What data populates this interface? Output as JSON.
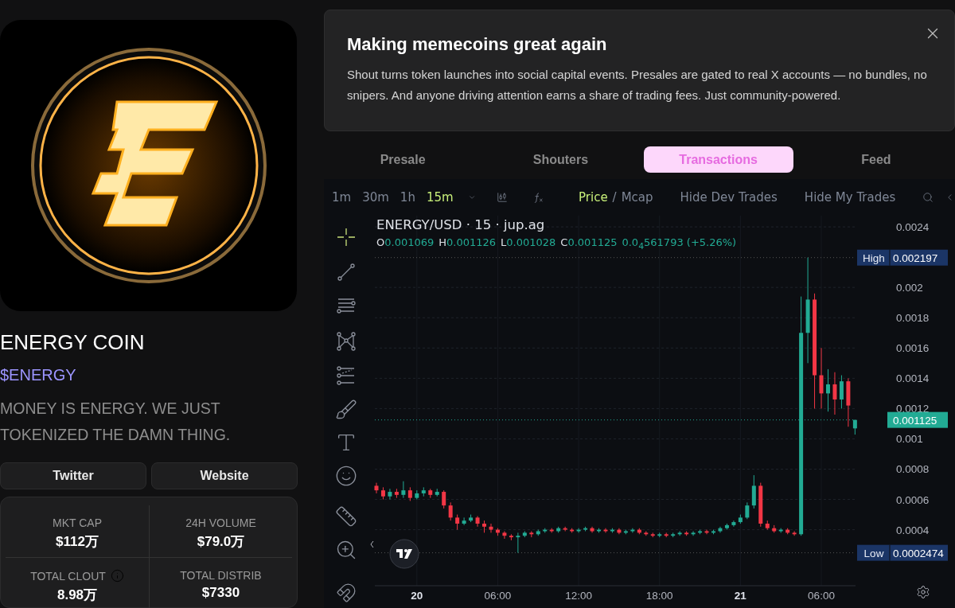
{
  "token": {
    "name": "ENERGY COIN",
    "ticker": "$ENERGY",
    "tagline": "MONEY IS ENERGY. WE JUST TOKENIZED THE DAMN THING."
  },
  "links": [
    "Twitter",
    "Website"
  ],
  "stats": [
    {
      "label": "MKT CAP",
      "value": "$112万",
      "info": false
    },
    {
      "label": "24H VOLUME",
      "value": "$79.0万",
      "info": false
    },
    {
      "label": "TOTAL CLOUT",
      "value": "8.98万",
      "info": true
    },
    {
      "label": "TOTAL DISTRIB",
      "value": "$7330",
      "info": false
    }
  ],
  "banner": {
    "title": "Making memecoins great again",
    "body": "Shout turns token launches into social capital events. Presales are gated to real X accounts — no bundles, no snipers. And anyone driving attention earns a share of trading fees. Just community-powered."
  },
  "tabs": [
    {
      "label": "Presale",
      "selected": false
    },
    {
      "label": "Shouters",
      "selected": false
    },
    {
      "label": "Transactions",
      "selected": true
    },
    {
      "label": "Feed",
      "selected": false
    }
  ],
  "chart": {
    "intervals": [
      {
        "label": "1m",
        "selected": false
      },
      {
        "label": "30m",
        "selected": false
      },
      {
        "label": "1h",
        "selected": false
      },
      {
        "label": "15m",
        "selected": true
      }
    ],
    "modes": [
      {
        "label": "Price",
        "selected": true
      },
      {
        "label": "Mcap",
        "selected": false
      }
    ],
    "mode_separator": "/",
    "toggles": [
      "Hide Dev Trades",
      "Hide My Trades"
    ],
    "symbol": "ENERGY/USD · 15 · jup.ag",
    "ohlc": [
      {
        "key": "O",
        "value": "0.001069"
      },
      {
        "key": "H",
        "value": "0.001126"
      },
      {
        "key": "L",
        "value": "0.001028"
      },
      {
        "key": "C",
        "value": "0.001125"
      }
    ],
    "change": "0.0$_{4}$561793 (+5.26%)",
    "x_labels_bold": [
      true,
      false,
      false,
      false,
      true,
      false
    ],
    "chart_data": {
      "type": "candlestick",
      "grid": true,
      "ylim": [
        3e-05,
        0.002474
      ],
      "yticks": [
        0.0024,
        0.002,
        0.0018,
        0.0016,
        0.0014,
        0.0012,
        0.001,
        0.0008,
        0.0006,
        0.0004
      ],
      "ref_lines": [
        {
          "axis": "y",
          "value": 0.002197,
          "color": "#555555"
        },
        {
          "axis": "y",
          "value": 0.0002474,
          "color": "#555555"
        },
        {
          "axis": "y",
          "value": 0.001125,
          "color": "#22ab94"
        }
      ],
      "categories": [
        null,
        null,
        null,
        null,
        null,
        null,
        "20",
        null,
        null,
        null,
        null,
        null,
        null,
        null,
        null,
        null,
        null,
        null,
        "06:00",
        null,
        null,
        null,
        null,
        null,
        null,
        null,
        null,
        null,
        null,
        null,
        "12:00",
        null,
        null,
        null,
        null,
        null,
        null,
        null,
        null,
        null,
        null,
        null,
        "18:00",
        null,
        null,
        null,
        null,
        null,
        null,
        null,
        null,
        null,
        null,
        null,
        "21",
        null,
        null,
        null,
        null,
        null,
        null,
        null,
        null,
        null,
        null,
        null,
        "06:00",
        null,
        null,
        null,
        null,
        null
      ],
      "ohlc": [
        [
          0.00069,
          0.00071,
          0.00064,
          0.00066
        ],
        [
          0.00066,
          0.00068,
          0.0006,
          0.00062
        ],
        [
          0.00062,
          0.00067,
          0.0006,
          0.00065
        ],
        [
          0.00065,
          0.00067,
          0.00061,
          0.00063
        ],
        [
          0.00063,
          0.00072,
          0.00061,
          0.00066
        ],
        [
          0.00066,
          0.00068,
          0.00059,
          0.00061
        ],
        [
          0.00061,
          0.00066,
          0.0006,
          0.00064
        ],
        [
          0.00064,
          0.00068,
          0.00062,
          0.00066
        ],
        [
          0.00066,
          0.00067,
          0.00061,
          0.00063
        ],
        [
          0.00063,
          0.00067,
          0.00062,
          0.00065
        ],
        [
          0.00065,
          0.00066,
          0.00054,
          0.00056
        ],
        [
          0.00056,
          0.00058,
          0.00046,
          0.00048
        ],
        [
          0.00048,
          0.0005,
          0.0004,
          0.00044
        ],
        [
          0.00044,
          0.00048,
          0.00043,
          0.00046
        ],
        [
          0.00046,
          0.0005,
          0.00045,
          0.00048
        ],
        [
          0.00048,
          0.00049,
          0.00042,
          0.00044
        ],
        [
          0.00044,
          0.00046,
          0.00038,
          0.00042
        ],
        [
          0.00042,
          0.00044,
          0.00038,
          0.0004
        ],
        [
          0.0004,
          0.00041,
          0.00036,
          0.00038
        ],
        [
          0.00038,
          0.00039,
          0.00034,
          0.00036
        ],
        [
          0.00036,
          0.00037,
          0.00033,
          0.00035
        ],
        [
          0.00035,
          0.00038,
          0.0002474,
          0.00036
        ],
        [
          0.00036,
          0.00039,
          0.00035,
          0.00038
        ],
        [
          0.00038,
          0.00039,
          0.00035,
          0.00037
        ],
        [
          0.00037,
          0.0004,
          0.00036,
          0.00039
        ],
        [
          0.00039,
          0.00041,
          0.00038,
          0.0004
        ],
        [
          0.0004,
          0.00041,
          0.00038,
          0.00039
        ],
        [
          0.00039,
          0.00042,
          0.00038,
          0.00041
        ],
        [
          0.00041,
          0.00042,
          0.00039,
          0.0004
        ],
        [
          0.0004,
          0.00041,
          0.00038,
          0.00039
        ],
        [
          0.00039,
          0.00041,
          0.00038,
          0.0004
        ],
        [
          0.0004,
          0.00042,
          0.00039,
          0.00041
        ],
        [
          0.00041,
          0.00042,
          0.00038,
          0.00039
        ],
        [
          0.00039,
          0.00041,
          0.00038,
          0.0004
        ],
        [
          0.0004,
          0.00041,
          0.00038,
          0.00039
        ],
        [
          0.00039,
          0.00041,
          0.00038,
          0.0004
        ],
        [
          0.0004,
          0.00041,
          0.00037,
          0.00038
        ],
        [
          0.00038,
          0.0004,
          0.00037,
          0.00039
        ],
        [
          0.00039,
          0.00041,
          0.00038,
          0.0004
        ],
        [
          0.0004,
          0.00041,
          0.00037,
          0.00038
        ],
        [
          0.00038,
          0.00039,
          0.00036,
          0.00037
        ],
        [
          0.00037,
          0.00038,
          0.00035,
          0.00036
        ],
        [
          0.00036,
          0.00038,
          0.00035,
          0.00037
        ],
        [
          0.00037,
          0.00038,
          0.00035,
          0.00036
        ],
        [
          0.00036,
          0.00038,
          0.00035,
          0.00037
        ],
        [
          0.00037,
          0.00039,
          0.00036,
          0.00038
        ],
        [
          0.00038,
          0.00039,
          0.00036,
          0.00037
        ],
        [
          0.00037,
          0.00039,
          0.00036,
          0.00038
        ],
        [
          0.00038,
          0.0004,
          0.00037,
          0.00039
        ],
        [
          0.00039,
          0.0004,
          0.00037,
          0.00038
        ],
        [
          0.00038,
          0.0004,
          0.00037,
          0.00039
        ],
        [
          0.00039,
          0.00042,
          0.00038,
          0.00041
        ],
        [
          0.00041,
          0.00044,
          0.0004,
          0.00043
        ],
        [
          0.00043,
          0.00046,
          0.00042,
          0.00045
        ],
        [
          0.00045,
          0.0005,
          0.00044,
          0.00048
        ],
        [
          0.00048,
          0.00058,
          0.00047,
          0.00056
        ],
        [
          0.00056,
          0.00076,
          0.00054,
          0.00069
        ],
        [
          0.00069,
          0.00071,
          0.00042,
          0.00044
        ],
        [
          0.00044,
          0.00046,
          0.0004,
          0.00041
        ],
        [
          0.00041,
          0.00043,
          0.00038,
          0.00039
        ],
        [
          0.00039,
          0.00041,
          0.00038,
          0.0004
        ],
        [
          0.0004,
          0.00041,
          0.00037,
          0.00038
        ],
        [
          0.00038,
          0.00039,
          0.00036,
          0.00037
        ],
        [
          0.00037,
          0.00194,
          0.00036,
          0.0017
        ],
        [
          0.0017,
          0.002197,
          0.0015,
          0.00192
        ],
        [
          0.00192,
          0.00196,
          0.0012,
          0.00142
        ],
        [
          0.00142,
          0.0016,
          0.0012,
          0.0013
        ],
        [
          0.0013,
          0.00146,
          0.00118,
          0.00136
        ],
        [
          0.00136,
          0.00144,
          0.00116,
          0.00126
        ],
        [
          0.00126,
          0.00142,
          0.0012,
          0.00138
        ],
        [
          0.00138,
          0.0014,
          0.00108,
          0.00122
        ],
        [
          0.001069,
          0.001126,
          0.001028,
          0.001125
        ]
      ]
    },
    "high": {
      "label": "High",
      "value": "0.002197"
    },
    "low": {
      "label": "Low",
      "value": "0.0002474"
    },
    "last_price": "0.001125"
  }
}
